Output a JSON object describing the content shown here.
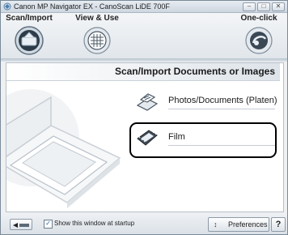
{
  "window": {
    "title": "Canon MP Navigator EX - CanoScan LiDE 700F",
    "controls": [
      "–",
      "□",
      "✕"
    ]
  },
  "toolbar": {
    "tabs": [
      {
        "label": "Scan/Import",
        "icon": "scan-import-icon",
        "selected": true
      },
      {
        "label": "View & Use",
        "icon": "view-use-icon",
        "selected": false
      },
      {
        "label": "One-click",
        "icon": "one-click-icon",
        "selected": false
      }
    ]
  },
  "panel": {
    "heading": "Scan/Import Documents or Images",
    "options": [
      {
        "label": "Photos/Documents (Platen)",
        "icon": "platen-icon"
      },
      {
        "label": "Film",
        "icon": "film-icon",
        "highlighted": true
      }
    ]
  },
  "statusbar": {
    "show_at_startup_label": "Show this window at startup",
    "show_at_startup_checked": true,
    "preferences_label": "Preferences",
    "preferences_icon": "↕",
    "help_label": "?"
  },
  "colors": {
    "accent": "#1a5fa8",
    "highlight_border": "#000000"
  }
}
